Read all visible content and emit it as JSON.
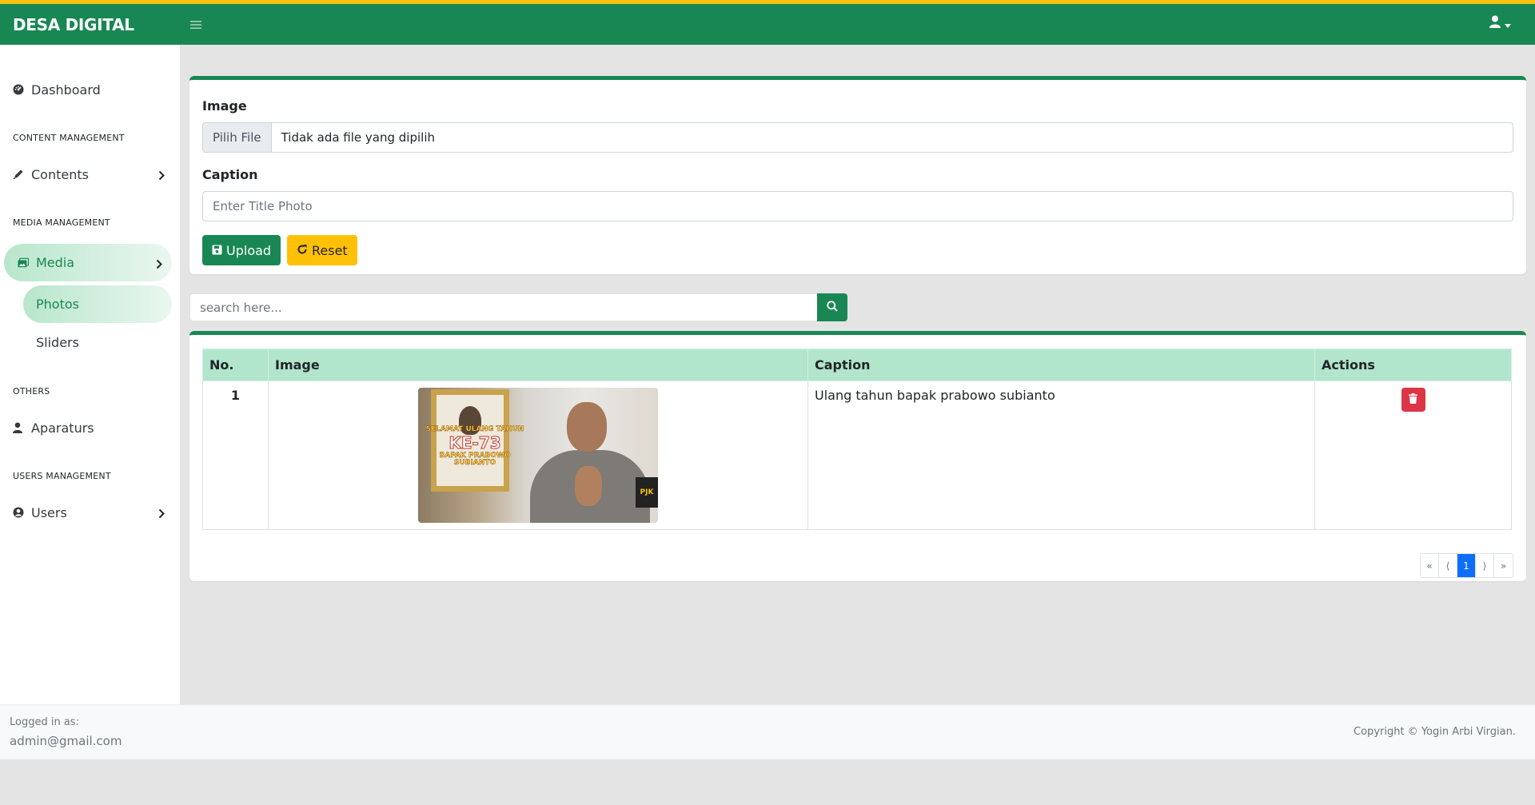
{
  "header": {
    "brand": "DESA DIGITAL",
    "colors": {
      "primary": "#198754",
      "accent": "#f5c211"
    }
  },
  "sidebar": {
    "dashboard": "Dashboard",
    "content_heading": "CONTENT MANAGEMENT",
    "contents": "Contents",
    "media_heading": "MEDIA MANAGEMENT",
    "media": "Media",
    "photos": "Photos",
    "sliders": "Sliders",
    "others_heading": "OTHERS",
    "aparaturs": "Aparaturs",
    "users_heading": "USERS MANAGEMENT",
    "users": "Users"
  },
  "form": {
    "image_label": "Image",
    "file_button": "Pilih File",
    "file_status": "Tidak ada file yang dipilih",
    "caption_label": "Caption",
    "caption_placeholder": "Enter Title Photo",
    "upload": "Upload",
    "reset": "Reset"
  },
  "search": {
    "placeholder": "search here..."
  },
  "table": {
    "headers": [
      "No.",
      "Image",
      "Caption",
      "Actions"
    ],
    "rows": [
      {
        "no": "1",
        "caption": "Ulang tahun bapak prabowo subianto",
        "image_text": [
          "SELAMAT ULANG TAHUN",
          "KE-73",
          "BAPAK PRABOWO SUBIANTO",
          "PJK"
        ]
      }
    ]
  },
  "pagination": {
    "first": "«",
    "prev": "⟨",
    "current": "1",
    "next": "⟩",
    "last": "»"
  },
  "footer": {
    "logged_in_label": "Logged in as:",
    "email": "admin@gmail.com",
    "copyright": "Copyright © Yogin Arbi Virgian."
  }
}
